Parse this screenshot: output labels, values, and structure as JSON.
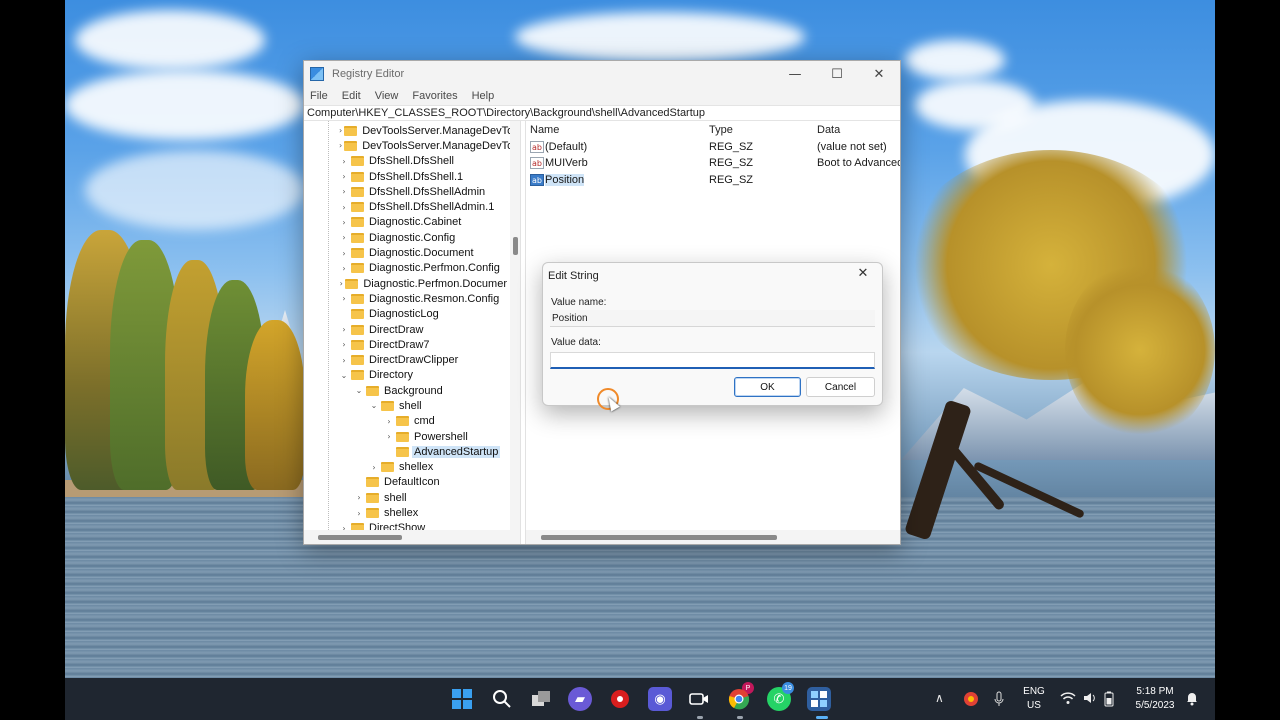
{
  "window": {
    "title": "Registry Editor",
    "minimize": "—",
    "maximize": "☐",
    "close": "✕"
  },
  "menu": [
    "File",
    "Edit",
    "View",
    "Favorites",
    "Help"
  ],
  "address": "Computer\\HKEY_CLASSES_ROOT\\Directory\\Background\\shell\\AdvancedStartup",
  "tree": [
    {
      "label": "DevToolsServer.ManageDevTo",
      "indent": 0,
      "chevron": "›"
    },
    {
      "label": "DevToolsServer.ManageDevTo",
      "indent": 0,
      "chevron": "›"
    },
    {
      "label": "DfsShell.DfsShell",
      "indent": 0,
      "chevron": "›"
    },
    {
      "label": "DfsShell.DfsShell.1",
      "indent": 0,
      "chevron": "›"
    },
    {
      "label": "DfsShell.DfsShellAdmin",
      "indent": 0,
      "chevron": "›"
    },
    {
      "label": "DfsShell.DfsShellAdmin.1",
      "indent": 0,
      "chevron": "›"
    },
    {
      "label": "Diagnostic.Cabinet",
      "indent": 0,
      "chevron": "›"
    },
    {
      "label": "Diagnostic.Config",
      "indent": 0,
      "chevron": "›"
    },
    {
      "label": "Diagnostic.Document",
      "indent": 0,
      "chevron": "›"
    },
    {
      "label": "Diagnostic.Perfmon.Config",
      "indent": 0,
      "chevron": "›"
    },
    {
      "label": "Diagnostic.Perfmon.Documer",
      "indent": 0,
      "chevron": "›"
    },
    {
      "label": "Diagnostic.Resmon.Config",
      "indent": 0,
      "chevron": "›"
    },
    {
      "label": "DiagnosticLog",
      "indent": 0,
      "chevron": ""
    },
    {
      "label": "DirectDraw",
      "indent": 0,
      "chevron": "›"
    },
    {
      "label": "DirectDraw7",
      "indent": 0,
      "chevron": "›"
    },
    {
      "label": "DirectDrawClipper",
      "indent": 0,
      "chevron": "›"
    },
    {
      "label": "Directory",
      "indent": 0,
      "chevron": "⌄"
    },
    {
      "label": "Background",
      "indent": 1,
      "chevron": "⌄"
    },
    {
      "label": "shell",
      "indent": 2,
      "chevron": "⌄"
    },
    {
      "label": "cmd",
      "indent": 3,
      "chevron": "›"
    },
    {
      "label": "Powershell",
      "indent": 3,
      "chevron": "›"
    },
    {
      "label": "AdvancedStartup",
      "indent": 3,
      "chevron": "",
      "selected": true
    },
    {
      "label": "shellex",
      "indent": 2,
      "chevron": "›"
    },
    {
      "label": "DefaultIcon",
      "indent": 1,
      "chevron": ""
    },
    {
      "label": "shell",
      "indent": 1,
      "chevron": "›"
    },
    {
      "label": "shellex",
      "indent": 1,
      "chevron": "›"
    },
    {
      "label": "DirectShow",
      "indent": 0,
      "chevron": "›"
    }
  ],
  "values": {
    "headers": {
      "name": "Name",
      "type": "Type",
      "data": "Data"
    },
    "icon_glyph": "ab",
    "rows": [
      {
        "name": "(Default)",
        "type": "REG_SZ",
        "data": "(value not set)"
      },
      {
        "name": "MUIVerb",
        "type": "REG_SZ",
        "data": "Boot to Advanced"
      },
      {
        "name": "Position",
        "type": "REG_SZ",
        "data": "",
        "selected": true
      }
    ]
  },
  "dialog": {
    "title": "Edit String",
    "close": "✕",
    "value_name_label": "Value name:",
    "value_name": "Position",
    "value_data_label": "Value data:",
    "value_data": "",
    "ok": "OK",
    "cancel": "Cancel"
  },
  "taskbar": {
    "lang_top": "ENG",
    "lang_bottom": "US",
    "time": "5:18 PM",
    "date": "5/5/2023",
    "badges": {
      "huawei": "P",
      "whatsapp": "19"
    },
    "tray_chevron": "∧"
  },
  "colors": {
    "accent": "#1f5fb5",
    "selection": "#cfe4f7",
    "taskbar": "#1f2630"
  }
}
